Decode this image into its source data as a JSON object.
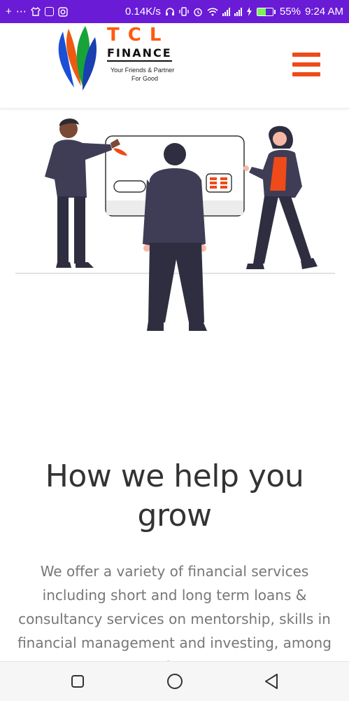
{
  "status_bar": {
    "left_icons": [
      "plus-icon",
      "more-dots-icon",
      "shirt-icon",
      "screenshot-icon",
      "instagram-icon"
    ],
    "net_speed": "0.14K/s",
    "right_icons": [
      "headset-icon",
      "vibrate-icon",
      "alarm-icon",
      "wifi-icon",
      "signal-icon",
      "signal-icon",
      "charging-icon",
      "battery-icon"
    ],
    "battery_level": 0.55,
    "battery_percent": "55%",
    "time": "9:24 AM",
    "bar_color": "#6a1bd6"
  },
  "header": {
    "logo": {
      "title": "TCL",
      "subtitle": "FINANCE",
      "tagline_line1": "Your Friends & Partner",
      "tagline_line2": "For Good"
    },
    "menu_icon": "hamburger-menu-icon",
    "accent_color": "#ee4a1a"
  },
  "hero": {
    "illustration": "team-with-credit-card-illustration"
  },
  "content": {
    "headline_line1": "How we help you",
    "headline_line2": "grow",
    "intro": "We offer a variety of financial services including short and long term loans & consultancy services on mentorship, skills in financial management and investing, among others"
  },
  "nav_bar": {
    "buttons": [
      "recents-square-icon",
      "home-circle-icon",
      "back-triangle-icon"
    ]
  }
}
